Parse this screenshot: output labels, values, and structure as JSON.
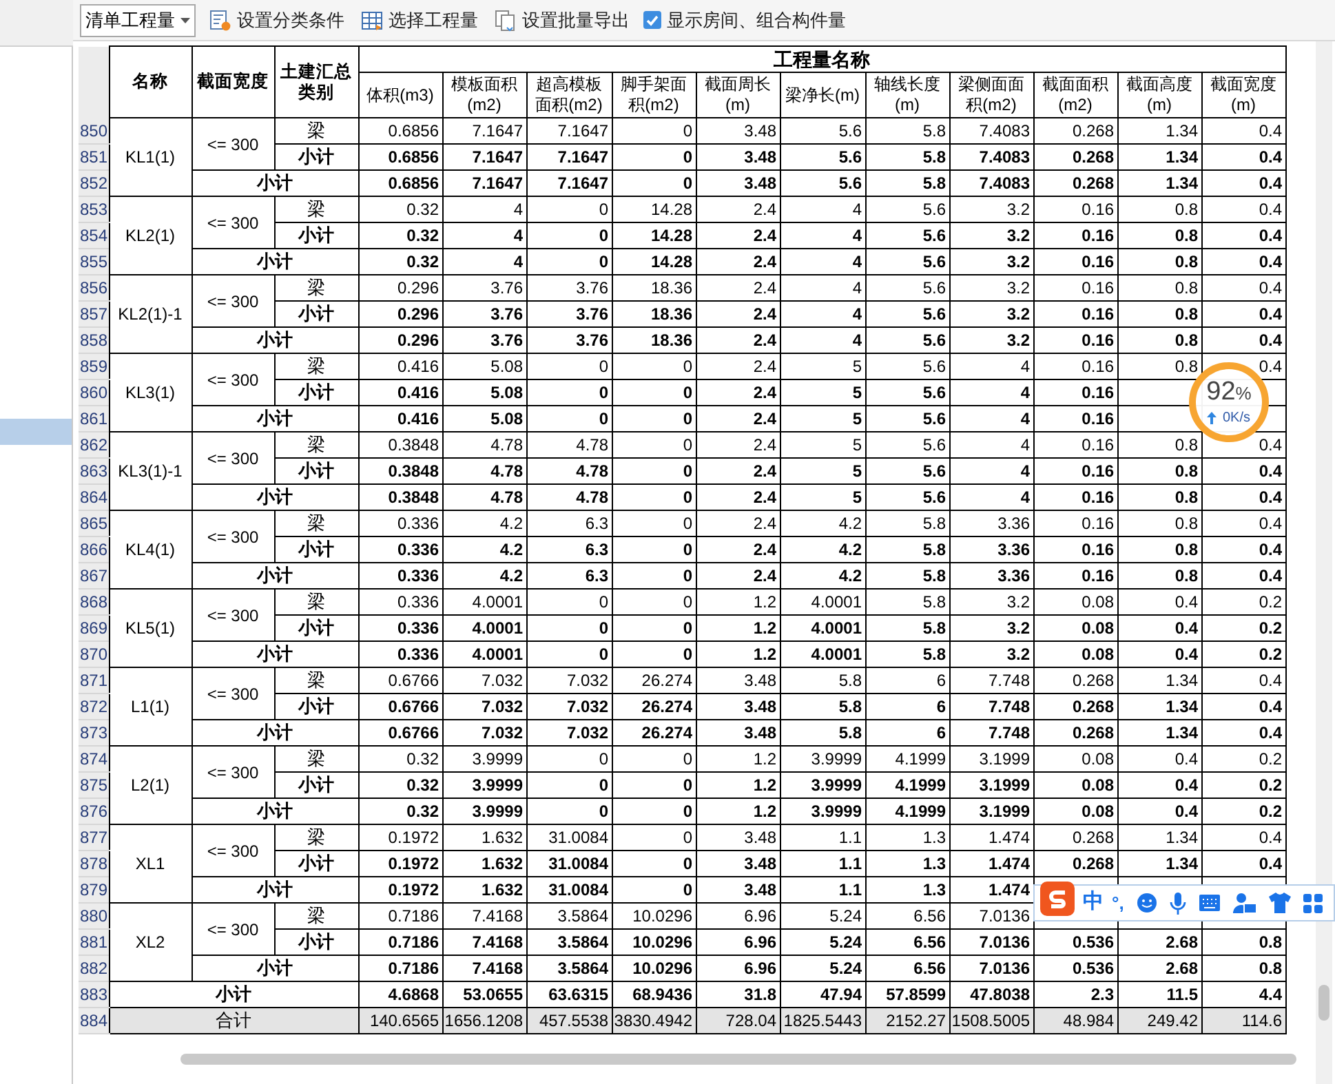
{
  "toolbar": {
    "dropdown": {
      "value": "清单工程量"
    },
    "buttons": [
      {
        "kind": "category",
        "label": "设置分类条件"
      },
      {
        "kind": "select",
        "label": "选择工程量"
      },
      {
        "kind": "export",
        "label": "设置批量导出"
      }
    ],
    "checkbox": {
      "label": "显示房间、组合构件量",
      "checked": true
    }
  },
  "sidebar": {
    "items": [
      {
        "selected": false
      },
      {
        "selected": false
      },
      {
        "selected": false
      },
      {
        "selected": false
      },
      {
        "selected": false
      },
      {
        "selected": false
      },
      {
        "selected": false
      },
      {
        "selected": false
      },
      {
        "selected": false
      },
      {
        "selected": false
      },
      {
        "selected": false
      },
      {
        "selected": false
      },
      {
        "selected": false
      },
      {
        "selected": false
      },
      {
        "selected": true
      },
      {
        "selected": false
      }
    ]
  },
  "table": {
    "headers": [
      "名称",
      "截面宽度",
      "土建汇总类别"
    ],
    "group_header": "工程量名称",
    "columns": [
      "体积(m3)",
      "模板面积(m2)",
      "超高模板面积(m2)",
      "脚手架面积(m2)",
      "截面周长(m)",
      "梁净长(m)",
      "轴线长度(m)",
      "梁侧面面积(m2)",
      "截面面积(m2)",
      "截面高度(m)",
      "截面宽度(m)"
    ],
    "groups": [
      {
        "name": "KL1(1)",
        "width": "<= 300",
        "rows": [
          {
            "row": "850",
            "kind": "item",
            "type": "梁",
            "values": [
              "0.6856",
              "7.1647",
              "7.1647",
              "0",
              "3.48",
              "5.6",
              "5.8",
              "7.4083",
              "0.268",
              "1.34",
              "0.4"
            ]
          },
          {
            "row": "851",
            "kind": "subtotal",
            "type": "小计",
            "values": [
              "0.6856",
              "7.1647",
              "7.1647",
              "0",
              "3.48",
              "5.6",
              "5.8",
              "7.4083",
              "0.268",
              "1.34",
              "0.4"
            ]
          },
          {
            "row": "852",
            "kind": "group_total",
            "type": "小计",
            "values": [
              "0.6856",
              "7.1647",
              "7.1647",
              "0",
              "3.48",
              "5.6",
              "5.8",
              "7.4083",
              "0.268",
              "1.34",
              "0.4"
            ]
          }
        ]
      },
      {
        "name": "KL2(1)",
        "width": "<= 300",
        "rows": [
          {
            "row": "853",
            "kind": "item",
            "type": "梁",
            "values": [
              "0.32",
              "4",
              "0",
              "14.28",
              "2.4",
              "4",
              "5.6",
              "3.2",
              "0.16",
              "0.8",
              "0.4"
            ]
          },
          {
            "row": "854",
            "kind": "subtotal",
            "type": "小计",
            "values": [
              "0.32",
              "4",
              "0",
              "14.28",
              "2.4",
              "4",
              "5.6",
              "3.2",
              "0.16",
              "0.8",
              "0.4"
            ]
          },
          {
            "row": "855",
            "kind": "group_total",
            "type": "小计",
            "values": [
              "0.32",
              "4",
              "0",
              "14.28",
              "2.4",
              "4",
              "5.6",
              "3.2",
              "0.16",
              "0.8",
              "0.4"
            ]
          }
        ]
      },
      {
        "name": "KL2(1)-1",
        "width": "<= 300",
        "rows": [
          {
            "row": "856",
            "kind": "item",
            "type": "梁",
            "values": [
              "0.296",
              "3.76",
              "3.76",
              "18.36",
              "2.4",
              "4",
              "5.6",
              "3.2",
              "0.16",
              "0.8",
              "0.4"
            ]
          },
          {
            "row": "857",
            "kind": "subtotal",
            "type": "小计",
            "values": [
              "0.296",
              "3.76",
              "3.76",
              "18.36",
              "2.4",
              "4",
              "5.6",
              "3.2",
              "0.16",
              "0.8",
              "0.4"
            ]
          },
          {
            "row": "858",
            "kind": "group_total",
            "type": "小计",
            "values": [
              "0.296",
              "3.76",
              "3.76",
              "18.36",
              "2.4",
              "4",
              "5.6",
              "3.2",
              "0.16",
              "0.8",
              "0.4"
            ]
          }
        ]
      },
      {
        "name": "KL3(1)",
        "width": "<= 300",
        "rows": [
          {
            "row": "859",
            "kind": "item",
            "type": "梁",
            "values": [
              "0.416",
              "5.08",
              "0",
              "0",
              "2.4",
              "5",
              "5.6",
              "4",
              "0.16",
              "0.8",
              "0.4"
            ]
          },
          {
            "row": "860",
            "kind": "subtotal",
            "type": "小计",
            "values": [
              "0.416",
              "5.08",
              "0",
              "0",
              "2.4",
              "5",
              "5.6",
              "4",
              "0.16"
            ]
          },
          {
            "row": "861",
            "kind": "group_total",
            "type": "小计",
            "values": [
              "0.416",
              "5.08",
              "0",
              "0",
              "2.4",
              "5",
              "5.6",
              "4",
              "0.16"
            ]
          }
        ]
      },
      {
        "name": "KL3(1)-1",
        "width": "<= 300",
        "rows": [
          {
            "row": "862",
            "kind": "item",
            "type": "梁",
            "values": [
              "0.3848",
              "4.78",
              "4.78",
              "0",
              "2.4",
              "5",
              "5.6",
              "4",
              "0.16",
              "0.8",
              "0.4"
            ]
          },
          {
            "row": "863",
            "kind": "subtotal",
            "type": "小计",
            "values": [
              "0.3848",
              "4.78",
              "4.78",
              "0",
              "2.4",
              "5",
              "5.6",
              "4",
              "0.16",
              "0.8",
              "0.4"
            ]
          },
          {
            "row": "864",
            "kind": "group_total",
            "type": "小计",
            "values": [
              "0.3848",
              "4.78",
              "4.78",
              "0",
              "2.4",
              "5",
              "5.6",
              "4",
              "0.16",
              "0.8",
              "0.4"
            ]
          }
        ]
      },
      {
        "name": "KL4(1)",
        "width": "<= 300",
        "rows": [
          {
            "row": "865",
            "kind": "item",
            "type": "梁",
            "values": [
              "0.336",
              "4.2",
              "6.3",
              "0",
              "2.4",
              "4.2",
              "5.8",
              "3.36",
              "0.16",
              "0.8",
              "0.4"
            ]
          },
          {
            "row": "866",
            "kind": "subtotal",
            "type": "小计",
            "values": [
              "0.336",
              "4.2",
              "6.3",
              "0",
              "2.4",
              "4.2",
              "5.8",
              "3.36",
              "0.16",
              "0.8",
              "0.4"
            ]
          },
          {
            "row": "867",
            "kind": "group_total",
            "type": "小计",
            "values": [
              "0.336",
              "4.2",
              "6.3",
              "0",
              "2.4",
              "4.2",
              "5.8",
              "3.36",
              "0.16",
              "0.8",
              "0.4"
            ]
          }
        ]
      },
      {
        "name": "KL5(1)",
        "width": "<= 300",
        "rows": [
          {
            "row": "868",
            "kind": "item",
            "type": "梁",
            "values": [
              "0.336",
              "4.0001",
              "0",
              "0",
              "1.2",
              "4.0001",
              "5.8",
              "3.2",
              "0.08",
              "0.4",
              "0.2"
            ]
          },
          {
            "row": "869",
            "kind": "subtotal",
            "type": "小计",
            "values": [
              "0.336",
              "4.0001",
              "0",
              "0",
              "1.2",
              "4.0001",
              "5.8",
              "3.2",
              "0.08",
              "0.4",
              "0.2"
            ]
          },
          {
            "row": "870",
            "kind": "group_total",
            "type": "小计",
            "values": [
              "0.336",
              "4.0001",
              "0",
              "0",
              "1.2",
              "4.0001",
              "5.8",
              "3.2",
              "0.08",
              "0.4",
              "0.2"
            ]
          }
        ]
      },
      {
        "name": "L1(1)",
        "width": "<= 300",
        "rows": [
          {
            "row": "871",
            "kind": "item",
            "type": "梁",
            "values": [
              "0.6766",
              "7.032",
              "7.032",
              "26.274",
              "3.48",
              "5.8",
              "6",
              "7.748",
              "0.268",
              "1.34",
              "0.4"
            ]
          },
          {
            "row": "872",
            "kind": "subtotal",
            "type": "小计",
            "values": [
              "0.6766",
              "7.032",
              "7.032",
              "26.274",
              "3.48",
              "5.8",
              "6",
              "7.748",
              "0.268",
              "1.34",
              "0.4"
            ]
          },
          {
            "row": "873",
            "kind": "group_total",
            "type": "小计",
            "values": [
              "0.6766",
              "7.032",
              "7.032",
              "26.274",
              "3.48",
              "5.8",
              "6",
              "7.748",
              "0.268",
              "1.34",
              "0.4"
            ]
          }
        ]
      },
      {
        "name": "L2(1)",
        "width": "<= 300",
        "rows": [
          {
            "row": "874",
            "kind": "item",
            "type": "梁",
            "values": [
              "0.32",
              "3.9999",
              "0",
              "0",
              "1.2",
              "3.9999",
              "4.1999",
              "3.1999",
              "0.08",
              "0.4",
              "0.2"
            ]
          },
          {
            "row": "875",
            "kind": "subtotal",
            "type": "小计",
            "values": [
              "0.32",
              "3.9999",
              "0",
              "0",
              "1.2",
              "3.9999",
              "4.1999",
              "3.1999",
              "0.08",
              "0.4",
              "0.2"
            ]
          },
          {
            "row": "876",
            "kind": "group_total",
            "type": "小计",
            "values": [
              "0.32",
              "3.9999",
              "0",
              "0",
              "1.2",
              "3.9999",
              "4.1999",
              "3.1999",
              "0.08",
              "0.4",
              "0.2"
            ]
          }
        ]
      },
      {
        "name": "XL1",
        "width": "<= 300",
        "rows": [
          {
            "row": "877",
            "kind": "item",
            "type": "梁",
            "values": [
              "0.1972",
              "1.632",
              "31.0084",
              "0",
              "3.48",
              "1.1",
              "1.3",
              "1.474",
              "0.268",
              "1.34",
              "0.4"
            ]
          },
          {
            "row": "878",
            "kind": "subtotal",
            "type": "小计",
            "values": [
              "0.1972",
              "1.632",
              "31.0084",
              "0",
              "3.48",
              "1.1",
              "1.3",
              "1.474",
              "0.268",
              "1.34",
              "0.4"
            ]
          },
          {
            "row": "879",
            "kind": "group_total",
            "type": "小计",
            "values": [
              "0.1972",
              "1.632",
              "31.0084",
              "0",
              "3.48",
              "1.1",
              "1.3",
              "1.474"
            ]
          }
        ]
      },
      {
        "name": "XL2",
        "width": "<= 300",
        "rows": [
          {
            "row": "880",
            "kind": "item",
            "type": "梁",
            "values": [
              "0.7186",
              "7.4168",
              "3.5864",
              "10.0296",
              "6.96",
              "5.24",
              "6.56",
              "7.0136"
            ]
          },
          {
            "row": "881",
            "kind": "subtotal",
            "type": "小计",
            "values": [
              "0.7186",
              "7.4168",
              "3.5864",
              "10.0296",
              "6.96",
              "5.24",
              "6.56",
              "7.0136",
              "0.536",
              "2.68",
              "0.8"
            ]
          },
          {
            "row": "882",
            "kind": "group_total",
            "type": "小计",
            "values": [
              "0.7186",
              "7.4168",
              "3.5864",
              "10.0296",
              "6.96",
              "5.24",
              "6.56",
              "7.0136",
              "0.536",
              "2.68",
              "0.8"
            ]
          }
        ]
      }
    ],
    "totals": [
      {
        "row": "883",
        "kind": "subtotal",
        "label": "小计",
        "values": [
          "4.6868",
          "53.0655",
          "63.6315",
          "68.9436",
          "31.8",
          "47.94",
          "57.8599",
          "47.8038",
          "2.3",
          "11.5",
          "4.4"
        ]
      },
      {
        "row": "884",
        "kind": "grand_total",
        "label": "合计",
        "values": [
          "140.6565",
          "1656.1208",
          "457.5538",
          "3830.4942",
          "728.04",
          "1825.5443",
          "2152.27",
          "1508.5005",
          "48.984",
          "249.42",
          "114.6"
        ]
      }
    ]
  },
  "speed_widget": {
    "percent": "92",
    "unit": "%",
    "rate": "0K/s"
  },
  "ime_toolbar": {
    "mode": "中",
    "punctuation": "°,"
  }
}
